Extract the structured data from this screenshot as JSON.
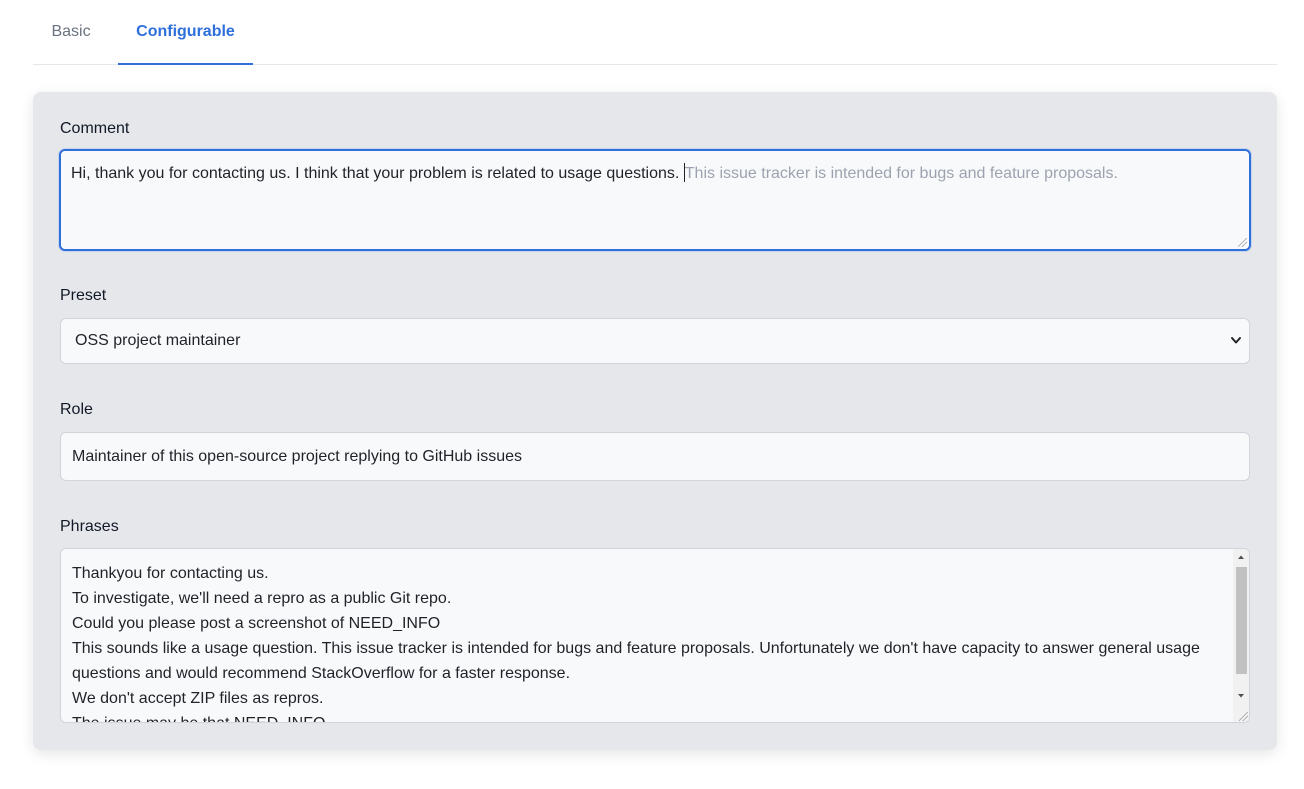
{
  "tabs": {
    "basic": "Basic",
    "configurable": "Configurable"
  },
  "comment": {
    "label": "Comment",
    "typed": "Hi, thank you for contacting us.  I think that your problem is related to usage questions. ",
    "suggestion": "This issue tracker is intended for bugs and feature proposals."
  },
  "preset": {
    "label": "Preset",
    "selected": "OSS project maintainer"
  },
  "role": {
    "label": "Role",
    "value": "Maintainer of this open-source project replying to GitHub issues"
  },
  "phrases": {
    "label": "Phrases",
    "lines": [
      "Thankyou for contacting us.",
      "To investigate, we'll need a repro as a public Git repo.",
      "Could you please post a screenshot of NEED_INFO",
      "This sounds like a usage question. This issue tracker is intended for bugs and feature proposals. Unfortunately we don't have capacity to answer general usage questions and would recommend StackOverflow for a faster response.",
      "We don't accept ZIP files as repros.",
      "The issue may be that NEED_INFO"
    ]
  },
  "colors": {
    "accent": "#2f6fdc",
    "panel_bg": "#e6e7eb",
    "suggestion_text": "#9ca3af"
  },
  "icons": {
    "select": "chevron-down-icon",
    "scroll_up": "triangle-up-icon",
    "scroll_down": "triangle-down-icon"
  }
}
